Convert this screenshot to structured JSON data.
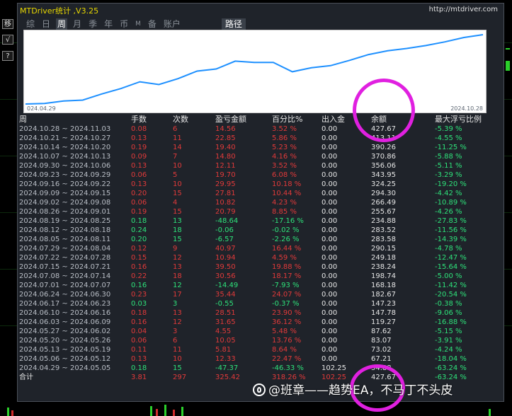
{
  "app": {
    "title": "MTDriver统计 ,V3.25",
    "url": "http://mtdriver.com"
  },
  "side_buttons": [
    "移",
    "√",
    "?"
  ],
  "tabs": [
    {
      "label": "综",
      "active": false
    },
    {
      "label": "日",
      "active": false
    },
    {
      "label": "周",
      "active": true
    },
    {
      "label": "月",
      "active": false
    },
    {
      "label": "季",
      "active": false
    },
    {
      "label": "年",
      "active": false
    },
    {
      "label": "币",
      "active": false
    },
    {
      "label": "M",
      "active": false
    },
    {
      "label": "备",
      "active": false
    },
    {
      "label": "账户",
      "active": false
    },
    {
      "label": "路径",
      "active": true
    }
  ],
  "equity_chart": {
    "start_date": "024.04.29",
    "end_date": "2024.10.28",
    "line_color": "#1e90ff",
    "balance_series": [
      67.21,
      70.0,
      83.07,
      87.62,
      119.27,
      147.23,
      182.67,
      168.18,
      198.74,
      238.24,
      249.18,
      290.15,
      283.58,
      283.52,
      234.88,
      255.67,
      266.49,
      294.3,
      324.25,
      343.95,
      356.06,
      370.86,
      390.26,
      413.11,
      427.67
    ]
  },
  "table": {
    "headers": [
      "周",
      "手数",
      "次数",
      "盈亏金额",
      "百分比%",
      "出入金",
      "余额",
      "最大浮亏比例"
    ],
    "rows": [
      {
        "week": "2024.10.28 ~ 2024.11.03",
        "lots": "0.08",
        "count": "6",
        "pl": "14.56",
        "pct": "3.52 %",
        "io": "0.00",
        "balance": "427.67",
        "dd": "-5.39 %",
        "sign": "pos"
      },
      {
        "week": "2024.10.21 ~ 2024.10.27",
        "lots": "0.13",
        "count": "11",
        "pl": "22.85",
        "pct": "5.86 %",
        "io": "0.00",
        "balance": "413.11",
        "dd": "-4.55 %",
        "sign": "pos"
      },
      {
        "week": "2024.10.14 ~ 2024.10.20",
        "lots": "0.19",
        "count": "14",
        "pl": "19.40",
        "pct": "5.23 %",
        "io": "0.00",
        "balance": "390.26",
        "dd": "-11.25 %",
        "sign": "pos"
      },
      {
        "week": "2024.10.07 ~ 2024.10.13",
        "lots": "0.09",
        "count": "7",
        "pl": "14.80",
        "pct": "4.16 %",
        "io": "0.00",
        "balance": "370.86",
        "dd": "-5.88 %",
        "sign": "pos"
      },
      {
        "week": "2024.09.30 ~ 2024.10.06",
        "lots": "0.13",
        "count": "10",
        "pl": "12.11",
        "pct": "3.52 %",
        "io": "0.00",
        "balance": "356.06",
        "dd": "-5.11 %",
        "sign": "pos"
      },
      {
        "week": "2024.09.23 ~ 2024.09.29",
        "lots": "0.06",
        "count": "5",
        "pl": "19.70",
        "pct": "6.08 %",
        "io": "0.00",
        "balance": "343.95",
        "dd": "-3.29 %",
        "sign": "pos"
      },
      {
        "week": "2024.09.16 ~ 2024.09.22",
        "lots": "0.13",
        "count": "10",
        "pl": "29.95",
        "pct": "10.18 %",
        "io": "0.00",
        "balance": "324.25",
        "dd": "-19.20 %",
        "sign": "pos"
      },
      {
        "week": "2024.09.09 ~ 2024.09.15",
        "lots": "0.20",
        "count": "15",
        "pl": "27.81",
        "pct": "10.44 %",
        "io": "0.00",
        "balance": "294.30",
        "dd": "-4.42 %",
        "sign": "pos"
      },
      {
        "week": "2024.09.02 ~ 2024.09.08",
        "lots": "0.06",
        "count": "4",
        "pl": "10.82",
        "pct": "4.23 %",
        "io": "0.00",
        "balance": "266.49",
        "dd": "-10.89 %",
        "sign": "pos"
      },
      {
        "week": "2024.08.26 ~ 2024.09.01",
        "lots": "0.19",
        "count": "15",
        "pl": "20.79",
        "pct": "8.85 %",
        "io": "0.00",
        "balance": "255.67",
        "dd": "-4.26 %",
        "sign": "pos"
      },
      {
        "week": "2024.08.19 ~ 2024.08.25",
        "lots": "0.18",
        "count": "13",
        "pl": "-48.64",
        "pct": "-17.16 %",
        "io": "0.00",
        "balance": "234.88",
        "dd": "-27.83 %",
        "sign": "neg"
      },
      {
        "week": "2024.08.12 ~ 2024.08.18",
        "lots": "0.24",
        "count": "18",
        "pl": "-0.06",
        "pct": "-0.02 %",
        "io": "0.00",
        "balance": "283.52",
        "dd": "-11.56 %",
        "sign": "neg"
      },
      {
        "week": "2024.08.05 ~ 2024.08.11",
        "lots": "0.20",
        "count": "15",
        "pl": "-6.57",
        "pct": "-2.26 %",
        "io": "0.00",
        "balance": "283.58",
        "dd": "-14.39 %",
        "sign": "neg"
      },
      {
        "week": "2024.07.29 ~ 2024.08.04",
        "lots": "0.12",
        "count": "9",
        "pl": "40.97",
        "pct": "16.44 %",
        "io": "0.00",
        "balance": "290.15",
        "dd": "-4.78 %",
        "sign": "pos"
      },
      {
        "week": "2024.07.22 ~ 2024.07.28",
        "lots": "0.15",
        "count": "12",
        "pl": "10.94",
        "pct": "4.59 %",
        "io": "0.00",
        "balance": "249.18",
        "dd": "-12.47 %",
        "sign": "pos"
      },
      {
        "week": "2024.07.15 ~ 2024.07.21",
        "lots": "0.16",
        "count": "13",
        "pl": "39.50",
        "pct": "19.88 %",
        "io": "0.00",
        "balance": "238.24",
        "dd": "-15.64 %",
        "sign": "pos"
      },
      {
        "week": "2024.07.08 ~ 2024.07.14",
        "lots": "0.22",
        "count": "18",
        "pl": "30.56",
        "pct": "18.17 %",
        "io": "0.00",
        "balance": "198.74",
        "dd": "-5.00 %",
        "sign": "pos"
      },
      {
        "week": "2024.07.01 ~ 2024.07.07",
        "lots": "0.16",
        "count": "12",
        "pl": "-14.49",
        "pct": "-7.93 %",
        "io": "0.00",
        "balance": "168.18",
        "dd": "-11.42 %",
        "sign": "neg"
      },
      {
        "week": "2024.06.24 ~ 2024.06.30",
        "lots": "0.23",
        "count": "17",
        "pl": "35.44",
        "pct": "24.07 %",
        "io": "0.00",
        "balance": "182.67",
        "dd": "-20.54 %",
        "sign": "pos"
      },
      {
        "week": "2024.06.17 ~ 2024.06.23",
        "lots": "0.03",
        "count": "3",
        "pl": "-0.55",
        "pct": "-0.37 %",
        "io": "0.00",
        "balance": "147.23",
        "dd": "-0.38 %",
        "sign": "neg"
      },
      {
        "week": "2024.06.10 ~ 2024.06.16",
        "lots": "0.18",
        "count": "13",
        "pl": "28.51",
        "pct": "23.90 %",
        "io": "0.00",
        "balance": "147.78",
        "dd": "-9.06 %",
        "sign": "pos"
      },
      {
        "week": "2024.06.03 ~ 2024.06.09",
        "lots": "0.16",
        "count": "12",
        "pl": "31.65",
        "pct": "36.12 %",
        "io": "0.00",
        "balance": "119.27",
        "dd": "-16.88 %",
        "sign": "pos"
      },
      {
        "week": "2024.05.27 ~ 2024.06.02",
        "lots": "0.04",
        "count": "3",
        "pl": "4.55",
        "pct": "5.48 %",
        "io": "0.00",
        "balance": "87.62",
        "dd": "-5.15 %",
        "sign": "pos"
      },
      {
        "week": "2024.05.20 ~ 2024.05.26",
        "lots": "0.06",
        "count": "6",
        "pl": "10.05",
        "pct": "13.76 %",
        "io": "0.00",
        "balance": "83.07",
        "dd": "-3.91 %",
        "sign": "pos"
      },
      {
        "week": "2024.05.13 ~ 2024.05.19",
        "lots": "0.11",
        "count": "11",
        "pl": "5.81",
        "pct": "8.64 %",
        "io": "0.00",
        "balance": "73.02",
        "dd": "-4.24 %",
        "sign": "pos"
      },
      {
        "week": "2024.05.06 ~ 2024.05.12",
        "lots": "0.13",
        "count": "10",
        "pl": "12.33",
        "pct": "22.47 %",
        "io": "0.00",
        "balance": "67.21",
        "dd": "-18.04 %",
        "sign": "pos"
      },
      {
        "week": "2024.04.29 ~ 2024.05.05",
        "lots": "0.18",
        "count": "15",
        "pl": "-47.37",
        "pct": "-46.33 %",
        "io": "102.25",
        "balance": "54.88",
        "dd": "-63.24 %",
        "sign": "neg"
      }
    ],
    "total": {
      "label": "合计",
      "lots": "3.81",
      "count": "297",
      "pl": "325.42",
      "pct": "318.26 %",
      "io": "102.25",
      "balance": "427.67",
      "dd": "-63.24 %"
    }
  },
  "watermark": {
    "text": "@班章——趋势EA，不马丁不头皮"
  }
}
